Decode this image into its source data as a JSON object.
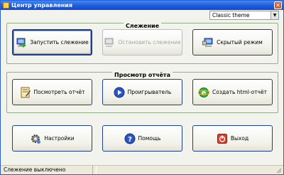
{
  "window": {
    "title": "Центр управления",
    "close_glyph": "✕"
  },
  "theme_selector": {
    "value": "Classic theme",
    "arrow": "▼"
  },
  "groups": {
    "monitoring": {
      "title": "Слежение",
      "buttons": [
        {
          "label": "Запустить слежение",
          "icon": "computer-start-icon"
        },
        {
          "label": "Остановить слежение",
          "icon": "computer-stop-icon"
        },
        {
          "label": "Скрытый режим",
          "icon": "hidden-mode-icon"
        }
      ]
    },
    "report": {
      "title": "Просмотр отчёта",
      "buttons": [
        {
          "label": "Посмотреть отчёт",
          "icon": "report-icon"
        },
        {
          "label": "Проигрыватель",
          "icon": "player-icon"
        },
        {
          "label": "Создать html-отчёт",
          "icon": "html-report-icon"
        }
      ]
    }
  },
  "bottom_buttons": [
    {
      "label": "Настройки",
      "icon": "settings-gear-icon"
    },
    {
      "label": "Помощь",
      "icon": "help-icon"
    },
    {
      "label": "Выход",
      "icon": "exit-icon"
    }
  ],
  "statusbar": {
    "status": "Слежение выключено",
    "second_cell": ""
  },
  "colors": {
    "title_bar": "#1d5bd8",
    "window_bg": "#f1f3ec",
    "group_border": "#8fb08a",
    "button_border": "#1f3f8c"
  }
}
